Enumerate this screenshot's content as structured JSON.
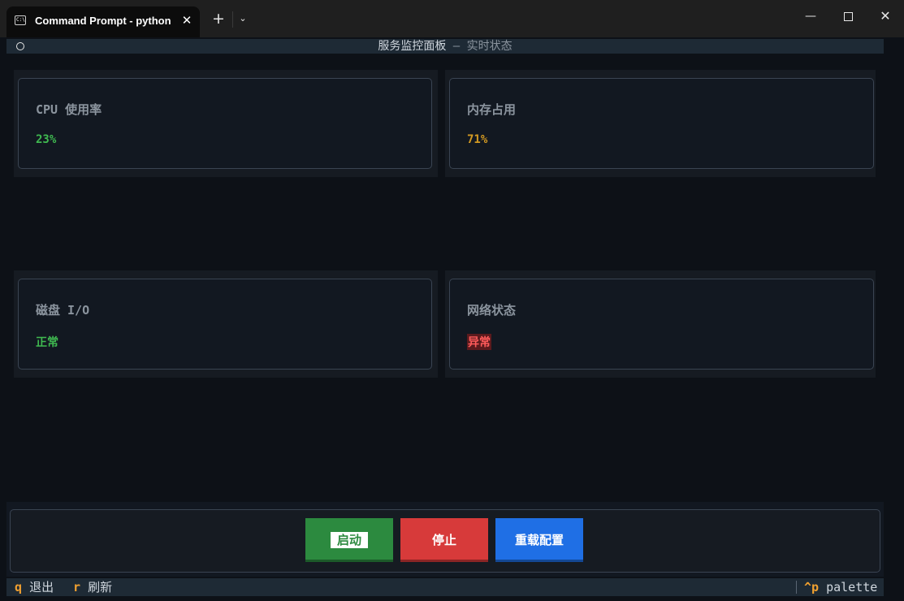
{
  "window": {
    "tab_title": "Command Prompt - python main.py",
    "tab_icon_text": "C:\\",
    "close_tab_glyph": "✕",
    "new_tab_glyph": "+",
    "dropdown_glyph": "⌄",
    "minimize_glyph": "—",
    "close_glyph": "✕"
  },
  "header": {
    "title": "服务监控面板",
    "separator": " – ",
    "subtitle": "实时状态"
  },
  "cards": [
    {
      "label": "CPU 使用率",
      "value": "23%",
      "status_color": "#3fb950"
    },
    {
      "label": "内存占用",
      "value": "71%",
      "status_color": "#d29922"
    },
    {
      "label": "磁盘 I/O",
      "value": "正常",
      "status_color": "#3fb950"
    },
    {
      "label": "网络状态",
      "value": "异常",
      "status_color": "#ff5b5b"
    }
  ],
  "buttons": {
    "start": "启动",
    "stop": "停止",
    "reload": "重载配置"
  },
  "colors": {
    "start": "#2c8a3f",
    "stop": "#d73a3a",
    "reload": "#1f6fe5",
    "key_hint": "#f0a030"
  },
  "footer": {
    "quit_key": "q",
    "quit_label": "退出",
    "refresh_key": "r",
    "refresh_label": "刷新",
    "palette_key": "^p",
    "palette_label": "palette"
  }
}
